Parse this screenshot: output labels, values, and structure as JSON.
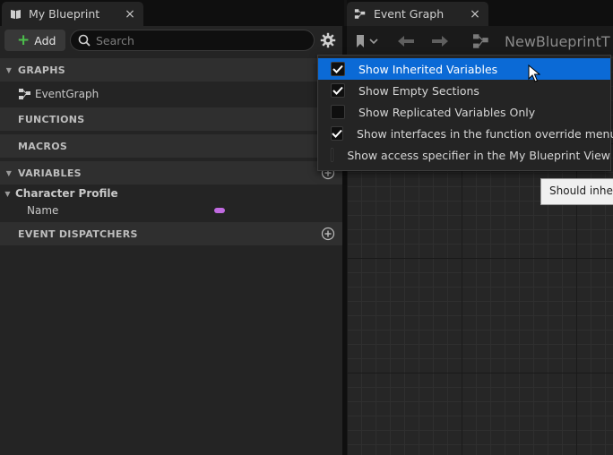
{
  "left_tab": {
    "title": "My Blueprint",
    "close": "×"
  },
  "right_tab": {
    "title": "Event Graph",
    "close": "×"
  },
  "toolbar": {
    "add_label": "Add",
    "search_placeholder": "Search"
  },
  "sections": {
    "graphs": "GRAPHS",
    "event_graph": "EventGraph",
    "functions": "FUNCTIONS",
    "macros": "MACROS",
    "variables": "VARIABLES",
    "category": "Character Profile",
    "var_name": "Name",
    "event_dispatchers": "EVENT DISPATCHERS"
  },
  "graph_toolbar": {
    "blueprint_name": "NewBlueprintT"
  },
  "menu": {
    "items": [
      {
        "label": "Show Inherited Variables",
        "checked": true,
        "highlighted": true
      },
      {
        "label": "Show Empty Sections",
        "checked": true,
        "highlighted": false
      },
      {
        "label": "Show Replicated Variables Only",
        "checked": false,
        "highlighted": false
      },
      {
        "label": "Show interfaces in the function override menu",
        "checked": true,
        "highlighted": false
      },
      {
        "label": "Show access specifier in the My Blueprint View",
        "checked": false,
        "highlighted": false
      }
    ]
  },
  "tooltip": {
    "text": "Should inheri"
  },
  "colors": {
    "accent": "#0b6ad6",
    "add_plus": "#4cc04c",
    "string_var": "#c06ae0"
  }
}
